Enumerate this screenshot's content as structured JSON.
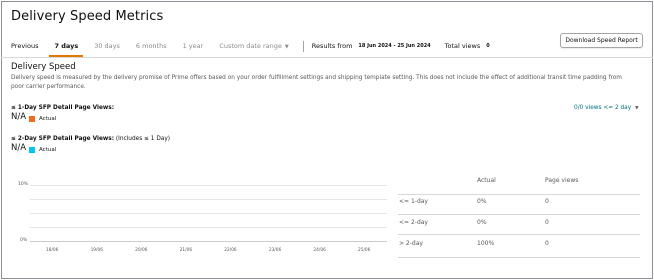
{
  "header": {
    "title": "Delivery Speed Metrics"
  },
  "tabs": [
    {
      "label": "Previous"
    },
    {
      "label": "7 days"
    },
    {
      "label": "30 days"
    },
    {
      "label": "6 months"
    },
    {
      "label": "1 year"
    },
    {
      "label": "Custom date range"
    }
  ],
  "toolbar": {
    "results_label": "Results from",
    "results_value": "18 Jun 2024 - 25 Jun 2024",
    "views_label": "Total views",
    "views_value": "0",
    "download_label": "Download Speed Report"
  },
  "section": {
    "title": "Delivery Speed",
    "description": "Delivery speed is measured by the delivery promise of Prime offers based on your order fulfillment settings and shipping template setting. This does not include the effect of additional transit time padding from poor carrier performance."
  },
  "metrics": [
    {
      "label": "≤ 1-Day SFP Detail Page Views:",
      "suffix": "",
      "value": "N/A",
      "legend": "Actual",
      "color": "#f26b21"
    },
    {
      "label": "≤ 2-Day SFP Detail Page Views:",
      "suffix": " (Includes ≤ 1 Day)",
      "value": "N/A",
      "legend": "Actual",
      "color": "#00c8f0"
    }
  ],
  "views_dropdown": {
    "label": "0/0 views <= 2 day"
  },
  "chart_data": {
    "type": "line",
    "x": [
      "18/06",
      "19/06",
      "20/06",
      "21/06",
      "22/06",
      "23/06",
      "24/06",
      "25/06"
    ],
    "yticks": [
      "10%",
      "0%"
    ],
    "ylim": [
      0,
      10
    ],
    "series": []
  },
  "table": {
    "headers": [
      "",
      "Actual",
      "Page views"
    ],
    "rows": [
      [
        "<= 1-day",
        "0%",
        "0"
      ],
      [
        "<= 2-day",
        "0%",
        "0"
      ],
      [
        "> 2-day",
        "100%",
        "0"
      ]
    ]
  }
}
